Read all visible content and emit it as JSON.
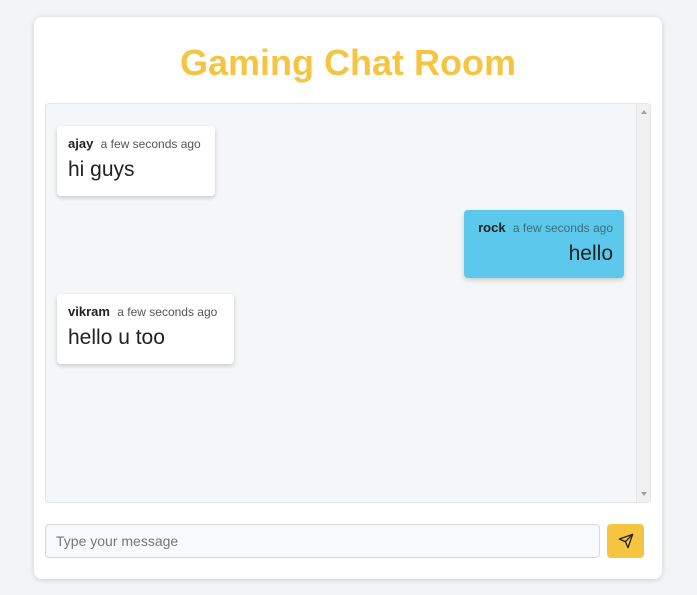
{
  "app": {
    "title": "Gaming Chat Room",
    "accent_color": "#f5c542",
    "own_message_color": "#5bc8ec"
  },
  "messages": [
    {
      "user": "ajay",
      "time": "a few seconds ago",
      "text": "hi guys",
      "side": "left"
    },
    {
      "user": "rock",
      "time": "a few seconds ago",
      "text": "hello",
      "side": "right"
    },
    {
      "user": "vikram",
      "time": "a few seconds ago",
      "text": "hello u too",
      "side": "left"
    }
  ],
  "composer": {
    "placeholder": "Type your message",
    "value": "",
    "send_icon": "send-icon"
  }
}
